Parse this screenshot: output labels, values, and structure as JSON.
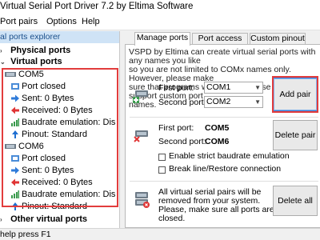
{
  "window": {
    "title": "Virtual Serial Port Driver 7.2 by Eltima Software"
  },
  "menu": [
    {
      "label": "Port pairs"
    },
    {
      "label": "Options"
    },
    {
      "label": "Help"
    }
  ],
  "explorer": {
    "header": "al ports explorer",
    "physical_ports": "Physical ports",
    "virtual_ports": "Virtual ports",
    "other_virtual_ports": "Other virtual ports",
    "pairs": [
      {
        "name": "COM5",
        "items": [
          "Port closed",
          "Sent: 0 Bytes",
          "Received: 0 Bytes",
          "Baudrate emulation: Dis",
          "Pinout: Standard"
        ]
      },
      {
        "name": "COM6",
        "items": [
          "Port closed",
          "Sent: 0 Bytes",
          "Received: 0 Bytes",
          "Baudrate emulation: Dis",
          "Pinout: Standard"
        ]
      }
    ]
  },
  "tabs": [
    {
      "label": "Manage ports",
      "active": true
    },
    {
      "label": "Port access list",
      "active": false
    },
    {
      "label": "Custom pinout",
      "active": false
    }
  ],
  "manage": {
    "description": [
      "VSPD by Eltima can create virtual serial ports with any names you like",
      "so you are not limited to COMx names only. However, please make",
      "sure that programs working with these ports support custom port",
      "names."
    ],
    "first_port_label": "First port:",
    "second_port_label": "Second port:",
    "first_port_value": "COM1",
    "second_port_value": "COM2",
    "add_pair_button": "Add pair",
    "existing_first_value": "COM5",
    "existing_second_value": "COM6",
    "delete_pair_button": "Delete pair",
    "strict_baudrate_label": "Enable strict baudrate emulation",
    "break_line_label": "Break line/Restore connection",
    "delete_all_text": [
      "All virtual serial pairs will be",
      "removed from your system.",
      "Please, make sure all ports are",
      "closed."
    ],
    "delete_all_button": "Delete all"
  },
  "status": {
    "text": "help press F1"
  },
  "colors": {
    "accent": "#1b4f8a",
    "highlight": "#e23c3c",
    "tree_arrow_send": "#2f7bd9",
    "tree_arrow_recv": "#e03535"
  }
}
